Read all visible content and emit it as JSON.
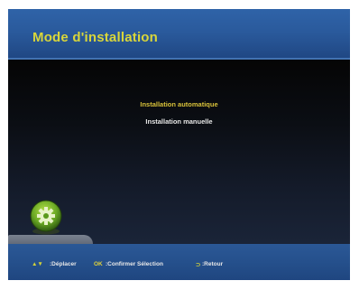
{
  "header": {
    "title": "Mode d'installation"
  },
  "menu": {
    "items": [
      {
        "label": "Installation automatique"
      },
      {
        "label": "Installation manuelle"
      }
    ],
    "selected_color": "#d9c23a",
    "normal_color": "#e8e8e8"
  },
  "footer": {
    "arrows_icon": "▲▼",
    "move_label": ":Déplacer",
    "ok_key": "OK",
    "confirm_label": ":Confirmer Sélection",
    "back_icon": "⊃",
    "back_label": ":Retour"
  },
  "icons": {
    "settings": "gear-icon"
  },
  "colors": {
    "accent_yellow": "#d9d63a",
    "header_blue": "#2f63a8"
  }
}
